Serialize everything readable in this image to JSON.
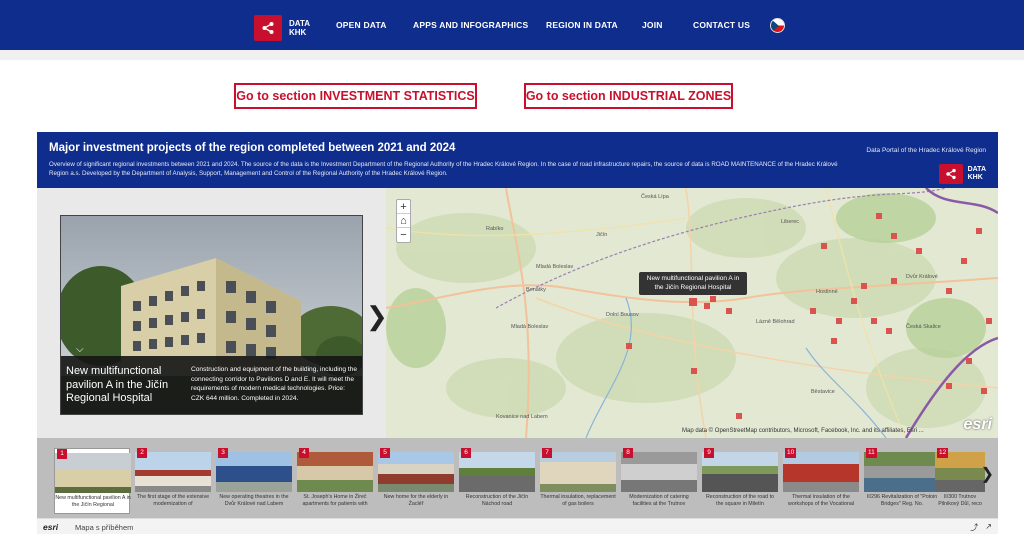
{
  "nav": {
    "logo_line1": "DATA",
    "logo_line2": "KHK",
    "items": [
      "OPEN DATA",
      "APPS AND INFOGRAPHICS",
      "REGION IN DATA",
      "JOIN",
      "CONTACT US"
    ]
  },
  "sections": {
    "investment": "Go to section INVESTMENT STATISTICS",
    "industrial": "Go to section INDUSTRIAL ZONES"
  },
  "story": {
    "title": "Major investment projects of the region completed between 2021 and 2024",
    "subtitle": "Overview of significant regional investments between 2021 and 2024. The source of the data is the Investment Department of the Regional Authority of the Hradec Králové Region. In the case of road infrastructure repairs, the source of data is ROAD MAINTENANCE of the Hradec Králové Region a.s. Developed by the Department of Analysis, Support, Management and Control of the Regional Authority of the Hradec Králové Region.",
    "portal": "Data Portal of the Hradec Králové Region",
    "logo_line1": "DATA",
    "logo_line2": "KHK"
  },
  "card": {
    "title": "New multifunctional pavilion A in the Jičín Regional Hospital",
    "description": "Construction and equipment of the building, including the connecting corridor to Pavilions D and E. It will meet the requirements of modern medical technologies. Price: CZK 644 million. Completed in 2024."
  },
  "map": {
    "tooltip": "New multifunctional pavilion A in the Jičín Regional Hospital",
    "attribution": "Map data © OpenStreetMap contributors, Microsoft, Facebook, Inc. and its affiliates, Esri ...",
    "logo": "esri",
    "zoom_in": "+",
    "home": "⌂",
    "zoom_out": "−"
  },
  "thumbs": [
    {
      "num": "1",
      "label": "New multifunctional pavilion A in the Jičín Regional"
    },
    {
      "num": "2",
      "label": "The first stage of the extensive modernization of"
    },
    {
      "num": "3",
      "label": "New operating theatres in the Dvůr Králové nad Labem"
    },
    {
      "num": "4",
      "label": "St. Joseph's Home in Žireč apartments for patients with"
    },
    {
      "num": "5",
      "label": "New home for the elderly in Žacléř"
    },
    {
      "num": "6",
      "label": "Reconstruction of the Jičín Náchod road"
    },
    {
      "num": "7",
      "label": "Thermal insulation, replacement of gas boilers"
    },
    {
      "num": "8",
      "label": "Modernization of catering facilities at the Trutnov"
    },
    {
      "num": "9",
      "label": "Reconstruction of the road to the square in Miletín"
    },
    {
      "num": "10",
      "label": "Thermal insulation of the workshops of the Vocational"
    },
    {
      "num": "11",
      "label": "II/296 Revitalization of \"Potoin Bridges\" Reg. No."
    },
    {
      "num": "12",
      "label": "II/300 Trutnov Pilnikový Důl, reco"
    }
  ],
  "footer": {
    "logo": "esri",
    "label": "Mapa s příběhem"
  }
}
